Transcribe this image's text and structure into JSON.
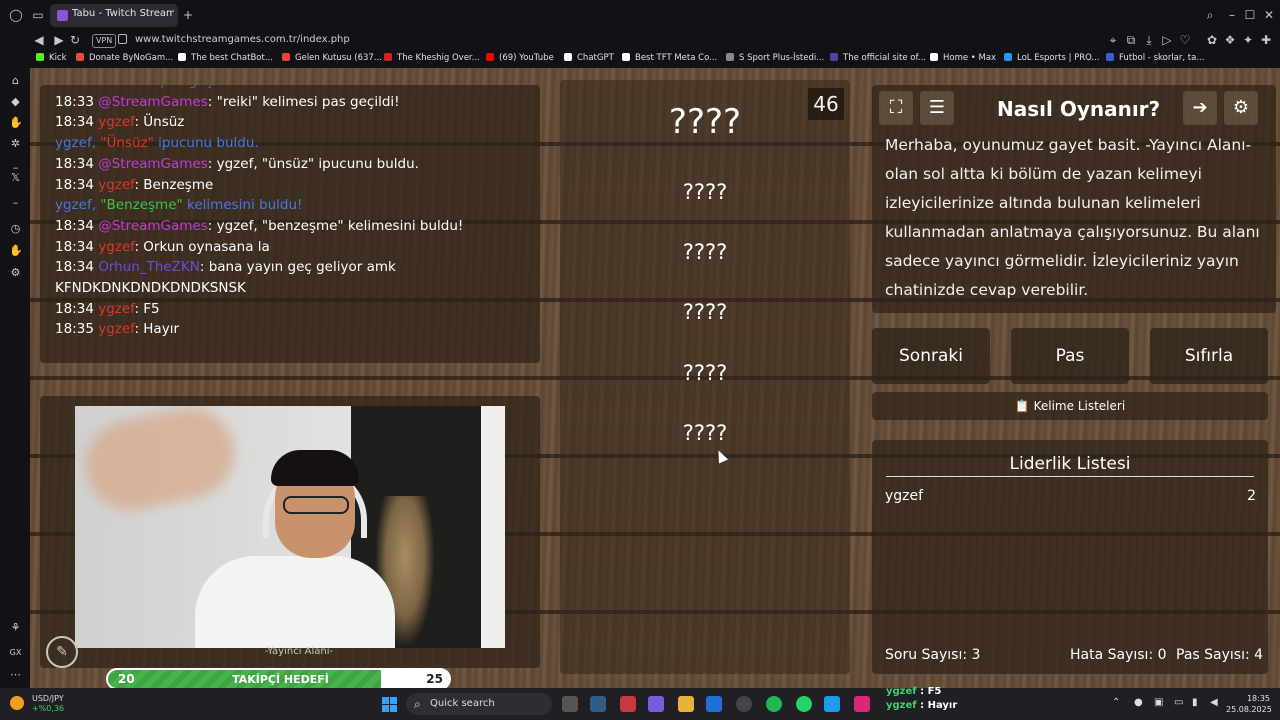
{
  "browser": {
    "tab_title": "Tabu - Twitch Stream Games",
    "url": "www.twitchstreamgames.com.tr/index.php",
    "vpn": "VPN",
    "bookmarks": [
      {
        "label": "Kick",
        "color": "#53fc18"
      },
      {
        "label": "Donate ByNoGam...",
        "color": "#e74c3c"
      },
      {
        "label": "The best ChatBot...",
        "color": "#ffffff"
      },
      {
        "label": "Gelen Kutusu (637...",
        "color": "#ea4335"
      },
      {
        "label": "The Kheshig Over...",
        "color": "#d61f1f"
      },
      {
        "label": "(69) YouTube",
        "color": "#ff0000"
      },
      {
        "label": "ChatGPT",
        "color": "#ffffff"
      },
      {
        "label": "Best TFT Meta Co...",
        "color": "#ffffff"
      },
      {
        "label": "S Sport Plus-İstedi...",
        "color": "#888888"
      },
      {
        "label": "The official site of...",
        "color": "#5b3fa0"
      },
      {
        "label": "Home • Max",
        "color": "#ffffff"
      },
      {
        "label": "LoL Esports | PRO...",
        "color": "#1d9bf0"
      },
      {
        "label": "Futbol - skorlar, ta...",
        "color": "#3b5bdb"
      }
    ]
  },
  "chat": {
    "lines": [
      {
        "time": "",
        "user": "",
        "text": "\"reiki\" kelimesi pas geçildi!",
        "kind": "cut"
      },
      {
        "time": "18:33",
        "user": "@StreamGames",
        "text": ": \"reiki\" kelimesi pas geçildi!",
        "kind": "sg"
      },
      {
        "time": "18:34",
        "user": "ygzef",
        "text": ": Ünsüz",
        "kind": "yg"
      },
      {
        "time": "",
        "user": "ygzef,",
        "word": "\"Ünsüz\"",
        "text": " ipucunu buldu.",
        "kind": "hint"
      },
      {
        "time": "18:34",
        "user": "@StreamGames",
        "text": ": ygzef, \"ünsüz\" ipucunu buldu.",
        "kind": "sg"
      },
      {
        "time": "18:34",
        "user": "ygzef",
        "text": ": Benzeşme",
        "kind": "yg"
      },
      {
        "time": "",
        "user": "ygzef,",
        "word": "\"Benzeşme\"",
        "text": " kelimesini buldu!",
        "kind": "found"
      },
      {
        "time": "18:34",
        "user": "@StreamGames",
        "text": ": ygzef, \"benzeşme\" kelimesini buldu!",
        "kind": "sg"
      },
      {
        "time": "18:34",
        "user": "ygzef",
        "text": ": Orkun oynasana la",
        "kind": "yg"
      },
      {
        "time": "18:34",
        "user": "Orhun_TheZKN",
        "text": ": bana yayın geç geliyor amk",
        "kind": "or"
      },
      {
        "time": "",
        "user": "",
        "text": "KFNDKDNKDNDKDNDKSNSK",
        "kind": "plain"
      },
      {
        "time": "18:34",
        "user": "ygzef",
        "text": ": F5",
        "kind": "yg"
      },
      {
        "time": "18:35",
        "user": "ygzef",
        "text": ": Hayır",
        "kind": "yg"
      }
    ]
  },
  "camera": {
    "label": "-Yayıncı Alanı-"
  },
  "goal": {
    "label": "TAKİPÇİ HEDEFİ",
    "current": "20",
    "target": "25",
    "progress": 0.8
  },
  "game": {
    "timer": "46",
    "words": [
      "????",
      "????",
      "????",
      "????",
      "????",
      "????"
    ]
  },
  "howto": {
    "title": "Nasıl Oynanır?",
    "text": "Merhaba, oyunumuz gayet basit. -Yayıncı Alanı- olan sol altta ki bölüm de yazan kelimeyi izleyicilerinize altında bulunan kelimeleri kullanmadan anlatmaya çalışıyorsunuz. Bu alanı sadece yayıncı görmelidir. İzleyicileriniz yayın chatinizde cevap verebilir."
  },
  "buttons": {
    "next": "Sonraki",
    "pass": "Pas",
    "reset": "Sıfırla",
    "lists": "Kelime Listeleri",
    "lists_icon": "📋"
  },
  "leaderboard": {
    "title": "Liderlik Listesi",
    "entries": [
      {
        "name": "ygzef",
        "score": "2"
      }
    ]
  },
  "stats": {
    "questions": "Soru Sayısı: 3",
    "errors": "Hata Sayısı: 0",
    "passes": "Pas Sayısı: 4"
  },
  "taskbar": {
    "fx_pair": "USD/JPY",
    "fx_change": "+%0,36",
    "search_placeholder": "Quick search",
    "chat_overlay": [
      {
        "name": "ygzef",
        "text": " : F5"
      },
      {
        "name": "ygzef",
        "text": " : Hayır"
      }
    ],
    "time": "18:35",
    "date": "25.08.2025"
  },
  "colors": {
    "streamgames": "#c23bd4",
    "ygzef": "#e0352b",
    "orhun": "#6a4dd8",
    "system": "#4578e6",
    "found_word": "#3cc44a",
    "goal_green": "#49b34b"
  }
}
